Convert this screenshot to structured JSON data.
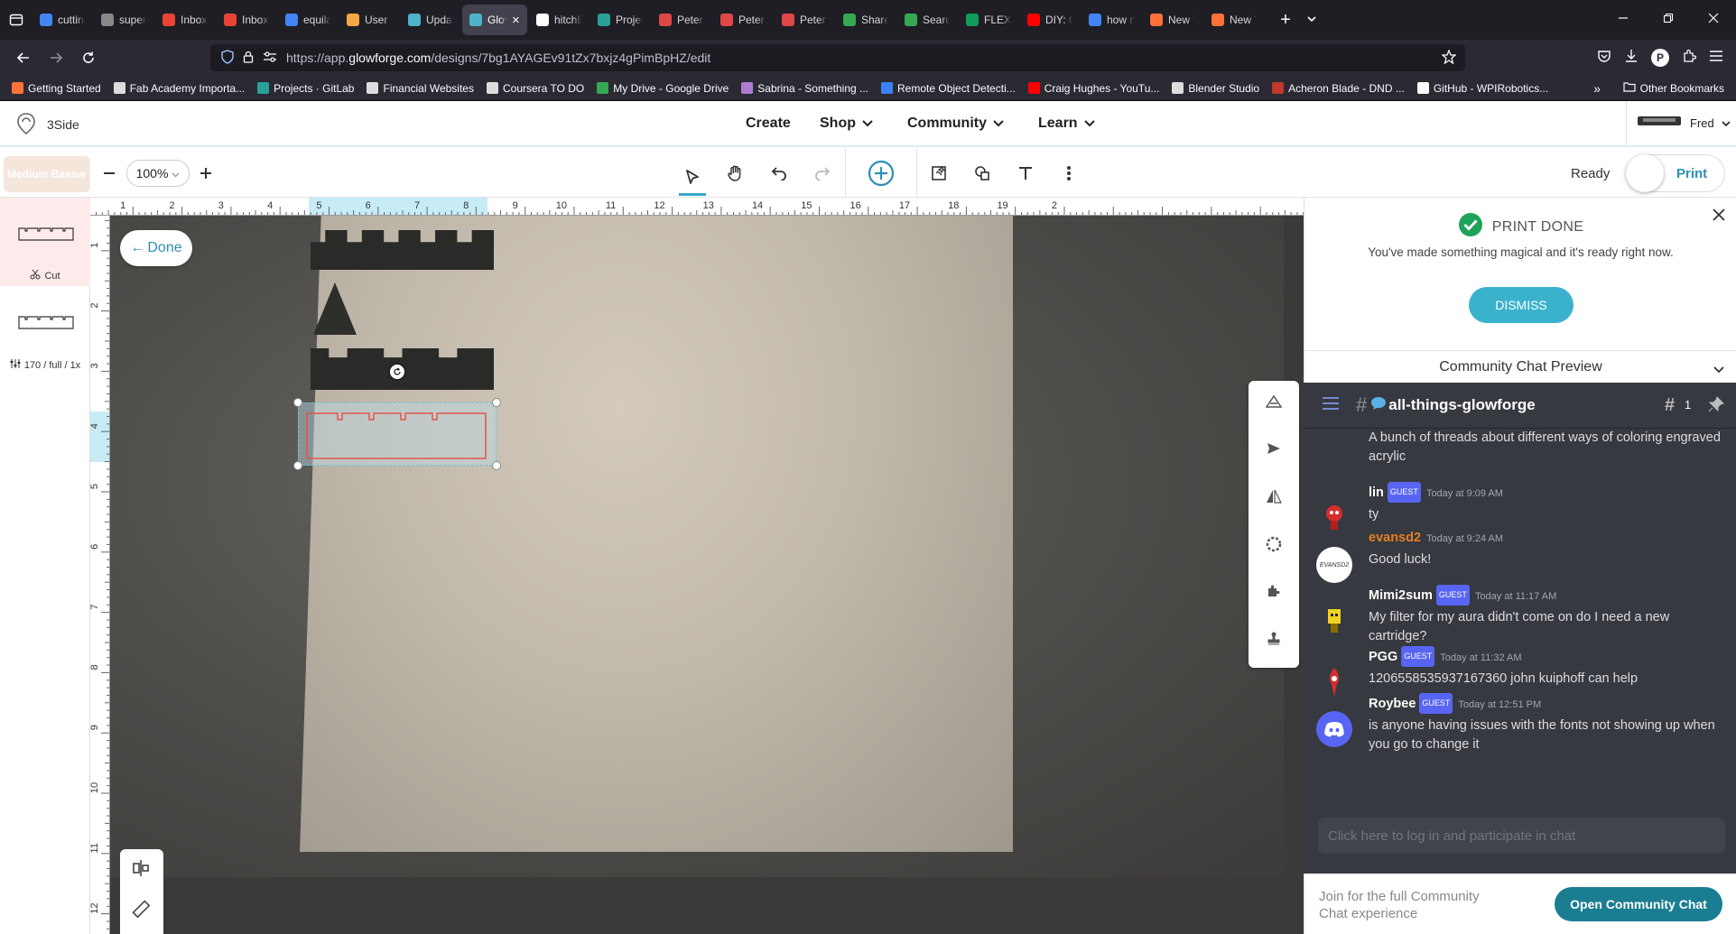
{
  "browser": {
    "tabs": [
      {
        "label": "cutting",
        "icon": "google-icon",
        "color": "#4285f4"
      },
      {
        "label": "super b",
        "icon": "page-icon",
        "color": "#888888"
      },
      {
        "label": "Inbox -",
        "icon": "gmail-icon",
        "color": "#ea4335"
      },
      {
        "label": "Inbox (",
        "icon": "gmail-icon",
        "color": "#ea4335"
      },
      {
        "label": "equilat",
        "icon": "google-icon",
        "color": "#4285f4"
      },
      {
        "label": "User Pa",
        "icon": "shield-icon",
        "color": "#f4a742"
      },
      {
        "label": "Update",
        "icon": "glowforge-icon",
        "color": "#4fb3c9"
      },
      {
        "label": "Glov",
        "icon": "glowforge-icon",
        "color": "#4fb3c9",
        "active": true
      },
      {
        "label": "hitchBC",
        "icon": "wikipedia-icon",
        "color": "#ffffff"
      },
      {
        "label": "Project",
        "icon": "gitlab-icon",
        "color": "#2aa198"
      },
      {
        "label": "Peter P",
        "icon": "fab-icon",
        "color": "#e04848"
      },
      {
        "label": "Peter P",
        "icon": "fab-icon",
        "color": "#e04848"
      },
      {
        "label": "Peter P",
        "icon": "fab-icon",
        "color": "#e04848"
      },
      {
        "label": "Shared",
        "icon": "drive-icon",
        "color": "#34a853"
      },
      {
        "label": "Search",
        "icon": "drive-icon",
        "color": "#34a853"
      },
      {
        "label": "FLEX D",
        "icon": "sheets-icon",
        "color": "#0f9d58"
      },
      {
        "label": "DIY: Cu",
        "icon": "youtube-icon",
        "color": "#ff0000"
      },
      {
        "label": "how m",
        "icon": "google-icon",
        "color": "#4285f4"
      },
      {
        "label": "New Ta",
        "icon": "firefox-icon",
        "color": "#ff7139"
      },
      {
        "label": "New Ta",
        "icon": "firefox-icon",
        "color": "#ff7139"
      }
    ],
    "url_prefix": "https://app.",
    "url_host": "glowforge.com",
    "url_path": "/designs/7bg1AYAGEv91tZx7bxjz4gPimBpHZ/edit",
    "bookmarks": [
      {
        "label": "Getting Started",
        "color": "#ff7139"
      },
      {
        "label": "Fab Academy Importa...",
        "color": "#dddddd"
      },
      {
        "label": "Projects · GitLab",
        "color": "#2aa198"
      },
      {
        "label": "Financial Websites",
        "color": "#dddddd"
      },
      {
        "label": "Coursera TO DO",
        "color": "#dddddd"
      },
      {
        "label": "My Drive - Google Drive",
        "color": "#34a853"
      },
      {
        "label": "Sabrina - Something ...",
        "color": "#b07cd0"
      },
      {
        "label": "Remote Object Detecti...",
        "color": "#3b82f6"
      },
      {
        "label": "Craig Hughes - YouTu...",
        "color": "#ff0000"
      },
      {
        "label": "Blender Studio",
        "color": "#dddddd"
      },
      {
        "label": "Acheron Blade - DND ...",
        "color": "#c0392b"
      },
      {
        "label": "GitHub - WPIRobotics...",
        "color": "#ffffff"
      }
    ],
    "other_bookmarks": "Other Bookmarks"
  },
  "app": {
    "design_name": "3Side",
    "menu": {
      "create": "Create",
      "shop": "Shop",
      "community": "Community",
      "learn": "Learn"
    },
    "user": "Fred",
    "material": "Medium Bassw",
    "zoom": "100%",
    "status": "Ready",
    "print_label": "Print"
  },
  "steps": [
    {
      "label": "Cut"
    },
    {
      "label": "170 / full / 1x"
    }
  ],
  "canvas": {
    "done_label": "Done",
    "ruler_h": [
      "1",
      "2",
      "3",
      "4",
      "5",
      "6",
      "7",
      "8",
      "9",
      "10",
      "11",
      "12",
      "13",
      "14",
      "15",
      "16",
      "17",
      "18",
      "19",
      "2"
    ],
    "ruler_v": [
      "1",
      "2",
      "3",
      "4",
      "5",
      "6",
      "7",
      "8",
      "9",
      "10",
      "11",
      "12"
    ]
  },
  "notification": {
    "title": "PRINT DONE",
    "message": "You've made something magical and it's ready right now.",
    "dismiss": "DISMISS"
  },
  "chat": {
    "preview_title": "Community Chat Preview",
    "channel": "all-things-glowforge",
    "thread_count": "1",
    "intro": "A bunch of threads about different ways of coloring engraved acrylic",
    "messages": [
      {
        "user": "lin",
        "guest": "GUEST",
        "time": "Today at 9:09 AM",
        "text": "ty",
        "color": "#ffffff"
      },
      {
        "user": "evansd2",
        "guest": "",
        "time": "Today at 9:24 AM",
        "text": "Good luck!",
        "color": "#e67e22"
      },
      {
        "user": "Mimi2sum",
        "guest": "GUEST",
        "time": "Today at 11:17 AM",
        "text": "My filter for my aura didn't come on do I need a new cartridge?",
        "color": "#ffffff"
      },
      {
        "user": "PGG",
        "guest": "GUEST",
        "time": "Today at 11:32 AM",
        "text": "1206558535937167360 john kuiphoff can help",
        "color": "#ffffff"
      },
      {
        "user": "Roybee",
        "guest": "GUEST",
        "time": "Today at 12:51 PM",
        "text": "is anyone having issues with the fonts not showing up when you go to change it",
        "color": "#ffffff"
      }
    ],
    "login_placeholder": "Click here to log in and participate in chat",
    "join_text": "Join for the full Community Chat experience",
    "open_chat": "Open Community Chat",
    "avatar_text": "EVANSD2"
  }
}
